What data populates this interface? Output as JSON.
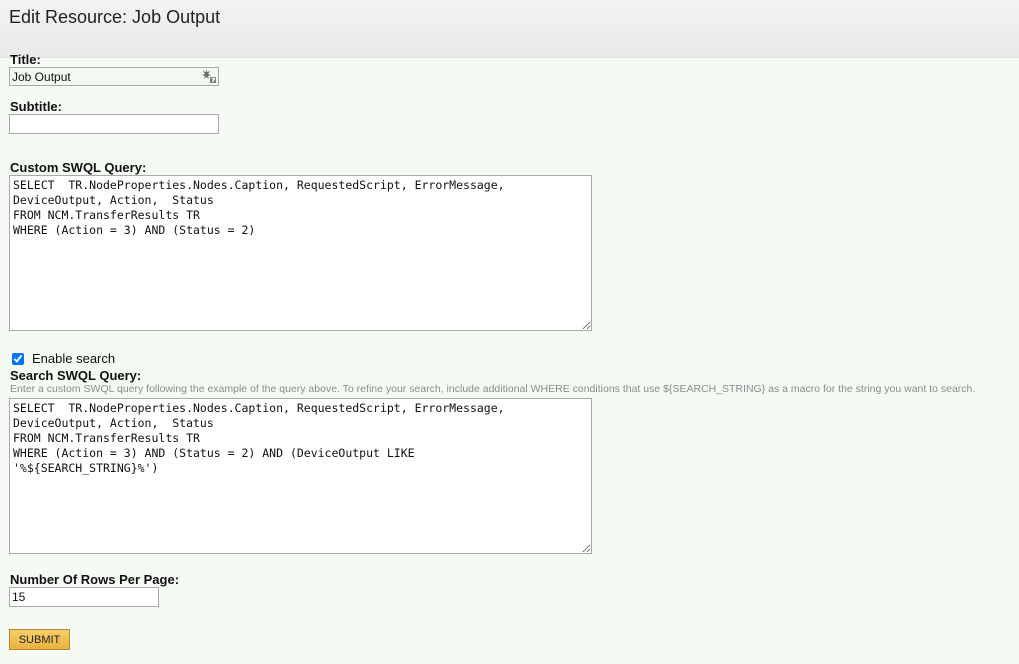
{
  "page": {
    "title": "Edit Resource: Job Output"
  },
  "form": {
    "title_label": "Title:",
    "title_value": "Job Output",
    "subtitle_label": "Subtitle:",
    "subtitle_value": "",
    "custom_query_label": "Custom SWQL Query:",
    "custom_query_value": "SELECT  TR.NodeProperties.Nodes.Caption, RequestedScript, ErrorMessage,\nDeviceOutput, Action,  Status\nFROM NCM.TransferResults TR\nWHERE (Action = 3) AND (Status = 2)",
    "enable_search_label": "Enable search",
    "enable_search_checked": true,
    "search_query_label": "Search SWQL Query:",
    "search_hint": "Enter a custom SWQL query following the example of the query above. To refine your search, include additional WHERE conditions that use ${SEARCH_STRING} as a macro for the string you want to search.",
    "search_query_value": "SELECT  TR.NodeProperties.Nodes.Caption, RequestedScript, ErrorMessage,\nDeviceOutput, Action,  Status\nFROM NCM.TransferResults TR\nWHERE (Action = 3) AND (Status = 2) AND (DeviceOutput LIKE\n'%${SEARCH_STRING}%')",
    "rows_label": "Number Of Rows Per Page:",
    "rows_value": "15",
    "submit_label": "SUBMIT"
  },
  "icons": {
    "macro": "macro-icon"
  },
  "colors": {
    "submit_button": "#e9b540",
    "page_background": "#f6faf5",
    "hint_text": "#8b8b8b"
  }
}
